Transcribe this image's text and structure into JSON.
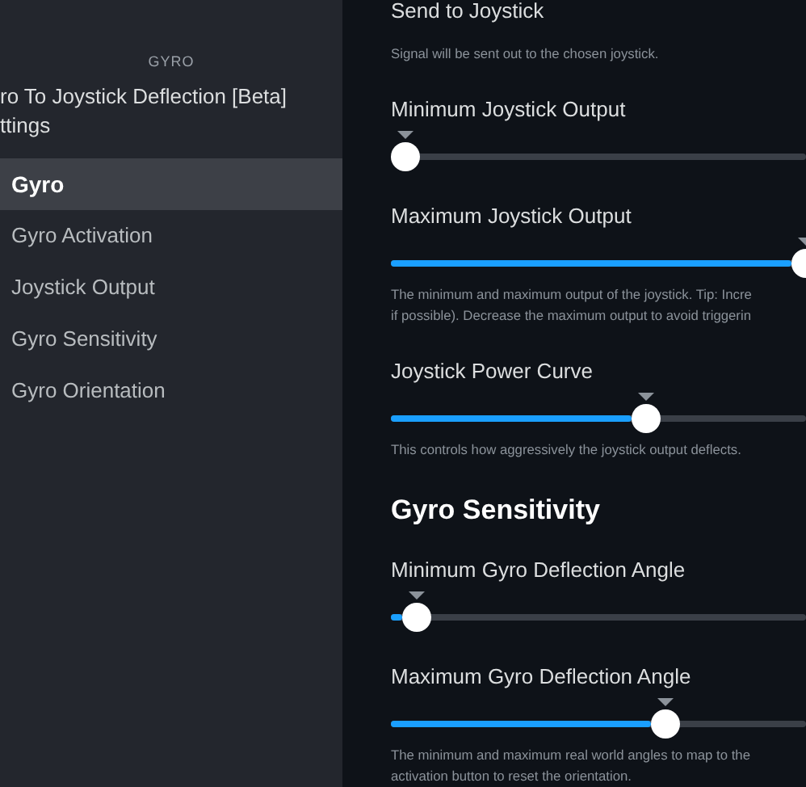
{
  "sidebar": {
    "section_label": "GYRO",
    "title_lines": [
      "ro To Joystick Deflection [Beta]",
      "ttings"
    ],
    "items": [
      {
        "label": "Gyro",
        "selected": true
      },
      {
        "label": "Gyro Activation",
        "selected": false
      },
      {
        "label": "Joystick Output",
        "selected": false
      },
      {
        "label": "Gyro Sensitivity",
        "selected": false
      },
      {
        "label": "Gyro Orientation",
        "selected": false
      }
    ]
  },
  "content": [
    {
      "kind": "label",
      "text": "Send to Joystick"
    },
    {
      "kind": "description",
      "lines": [
        "Signal will be sent out to the chosen joystick."
      ]
    },
    {
      "kind": "label",
      "text": "Minimum Joystick Output"
    },
    {
      "kind": "slider",
      "level": 0.035
    },
    {
      "kind": "label",
      "text": "Maximum Joystick Output"
    },
    {
      "kind": "slider",
      "level": 1
    },
    {
      "kind": "description",
      "lines": [
        "The minimum and maximum output of the joystick. Tip: Incre",
        "if possible). Decrease the maximum output to avoid triggerin"
      ]
    },
    {
      "kind": "label",
      "text": "Joystick Power Curve"
    },
    {
      "kind": "slider",
      "level": 0.615
    },
    {
      "kind": "description",
      "lines": [
        "This controls how aggressively the joystick output deflects."
      ]
    },
    {
      "kind": "heading",
      "text": "Gyro Sensitivity"
    },
    {
      "kind": "label",
      "text": "Minimum Gyro Deflection Angle"
    },
    {
      "kind": "slider",
      "level": 0.062
    },
    {
      "kind": "label",
      "text": "Maximum Gyro Deflection Angle"
    },
    {
      "kind": "slider",
      "level": 0.66
    },
    {
      "kind": "description",
      "lines": [
        "The minimum and maximum real world angles to map to the",
        "activation button to reset the orientation."
      ]
    }
  ]
}
